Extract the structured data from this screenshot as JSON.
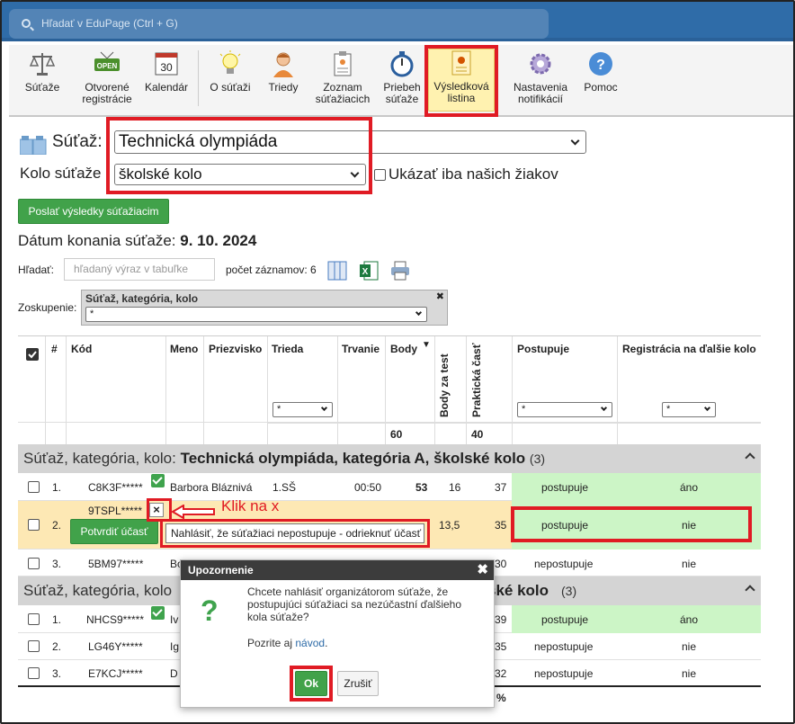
{
  "search": {
    "placeholder": "Hľadať v EduPage (Ctrl + G)"
  },
  "toolbar": {
    "items": [
      {
        "label": "Súťaže",
        "icon": "scales-icon"
      },
      {
        "label": "Otvorené registrácie",
        "icon": "open-sign-icon",
        "badge": "OPEN"
      },
      {
        "label": "Kalendár",
        "icon": "calendar-icon",
        "badge": "30"
      },
      {
        "label": "O súťaži",
        "icon": "lightbulb-icon"
      },
      {
        "label": "Triedy",
        "icon": "person-icon"
      },
      {
        "label": "Zoznam súťažiacich",
        "icon": "clipboard-icon"
      },
      {
        "label": "Priebeh súťaže",
        "icon": "stopwatch-icon"
      },
      {
        "label": "Výsledková listina",
        "icon": "certificate-icon"
      },
      {
        "label": "Nastavenia notifikácií",
        "icon": "gear-icon"
      },
      {
        "label": "Pomoc",
        "icon": "help-icon",
        "badge": "?"
      }
    ]
  },
  "filters": {
    "competition_label": "Súťaž:",
    "competition_value": "Technická olympiáda",
    "round_label": "Kolo súťaže",
    "round_value": "školské kolo",
    "only_ours_label": "Ukázať iba našich žiakov"
  },
  "send_results_button": "Poslať výsledky súťažiacim",
  "date": {
    "label": "Dátum konania súťaže:",
    "value": "9. 10. 2024"
  },
  "tools": {
    "search_label": "Hľadať:",
    "search_placeholder": "hľadaný výraz v tabuľke",
    "count_label": "počet záznamov: 6"
  },
  "grouping": {
    "label": "Zoskupenie:",
    "title": "Súťaž, kategória, kolo",
    "value": "*",
    "close": "✖"
  },
  "table": {
    "headers": {
      "num": "#",
      "code": "Kód",
      "name": "Meno",
      "surname": "Priezvisko",
      "class": "Trieda",
      "duration": "Trvanie",
      "points": "Body",
      "test_points": "Body za test",
      "practical": "Praktická časť",
      "advances": "Postupuje",
      "registration": "Registrácia na ďalšie kolo"
    },
    "filter_value": "*",
    "max_points": "60",
    "max_practical": "40",
    "sort_arrow": "▼",
    "group_prefix": "Súťaž, kategória, kolo:",
    "groups": [
      {
        "title": "Technická olympiáda, kategória A, školské kolo",
        "count": "(3)"
      },
      {
        "title": "ské kolo",
        "count": "(3)",
        "prefix": "Súťaž, kategória, kolo"
      }
    ],
    "rows": [
      {
        "num": "1.",
        "code": "C8K3F*****",
        "name": "Barbora Bláznivá",
        "class": "1.SŠ",
        "duration": "00:50",
        "points": "53",
        "test": "16",
        "practical": "37",
        "advances": "postupuje",
        "registration": "áno"
      },
      {
        "num": "2.",
        "code": "9TSPL*****",
        "confirm": "Potvrdiť účasť",
        "test": "13,5",
        "practical": "35",
        "advances": "postupuje",
        "registration": "nie"
      },
      {
        "num": "3.",
        "code": "5BM97*****",
        "name": "Bo",
        "practical": "30",
        "advances": "nepostupuje",
        "registration": "nie"
      },
      {
        "num": "1.",
        "code": "NHCS9*****",
        "name": "Iv",
        "practical": "39",
        "advances": "postupuje",
        "registration": "áno"
      },
      {
        "num": "2.",
        "code": "LG46Y*****",
        "name": "Ig",
        "practical": "35",
        "advances": "nepostupuje",
        "registration": "nie"
      },
      {
        "num": "3.",
        "code": "E7KCJ*****",
        "name": "D",
        "practical": "32",
        "advances": "nepostupuje",
        "registration": "nie"
      }
    ],
    "footer_percent": "%"
  },
  "tooltip": "Nahlásiť, že súťažiaci nepostupuje - odrieknuť účasť",
  "annotation": "Klik na x",
  "dialog": {
    "title": "Upozornenie",
    "close": "✖",
    "icon": "?",
    "message": "Chcete nahlásiť organizátorom súťaže, že postupujúci súťažiaci sa nezúčastní ďalšieho kola súťaže?",
    "help_prefix": "Pozrite aj",
    "help_link": "návod",
    "help_suffix": ".",
    "ok": "Ok",
    "cancel": "Zrušiť"
  },
  "colors": {
    "accent": "#2f6ca8",
    "highlight": "#e01b24",
    "advance_bg": "#ccf5c6",
    "selected_row": "#fde8b4",
    "green": "#41a24a"
  }
}
